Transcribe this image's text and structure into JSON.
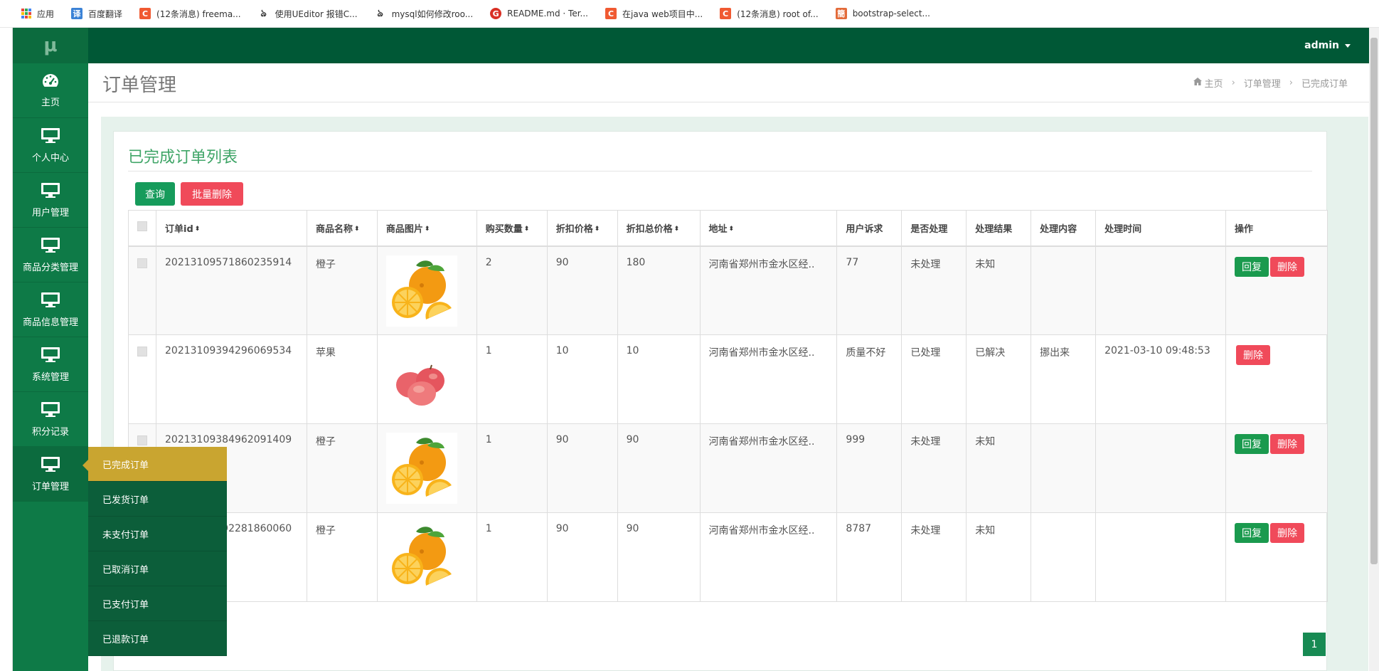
{
  "bookmarks": [
    {
      "icon": "apps-icon",
      "label": "应用"
    },
    {
      "icon": "translate-icon",
      "label": "百度翻译"
    },
    {
      "icon": "csdn-icon",
      "label": "(12条消息) freema..."
    },
    {
      "icon": "yuque-icon",
      "label": "使用UEditor 报错C..."
    },
    {
      "icon": "yuque-icon",
      "label": "mysql如何修改roo..."
    },
    {
      "icon": "gitee-icon",
      "label": "README.md · Ter..."
    },
    {
      "icon": "csdn-icon",
      "label": "在java web项目中..."
    },
    {
      "icon": "csdn-icon",
      "label": "(12条消息) root of..."
    },
    {
      "icon": "jianshu-icon",
      "label": "bootstrap-select..."
    }
  ],
  "logo": "μ",
  "user": {
    "name": "admin"
  },
  "sidebar": {
    "items": [
      {
        "label": "主页",
        "icon": "dashboard-icon"
      },
      {
        "label": "个人中心",
        "icon": "monitor-icon"
      },
      {
        "label": "用户管理",
        "icon": "monitor-icon"
      },
      {
        "label": "商品分类管理",
        "icon": "monitor-icon"
      },
      {
        "label": "商品信息管理",
        "icon": "monitor-icon"
      },
      {
        "label": "系统管理",
        "icon": "monitor-icon"
      },
      {
        "label": "积分记录",
        "icon": "monitor-icon"
      },
      {
        "label": "订单管理",
        "icon": "monitor-icon"
      }
    ]
  },
  "submenu": {
    "items": [
      "已完成订单",
      "已发货订单",
      "未支付订单",
      "已取消订单",
      "已支付订单",
      "已退款订单"
    ]
  },
  "page": {
    "title": "订单管理",
    "breadcrumb": [
      "主页",
      "订单管理",
      "已完成订单"
    ]
  },
  "panel": {
    "title": "已完成订单列表",
    "query_label": "查询",
    "batch_delete_label": "批量删除"
  },
  "table": {
    "headers": [
      "订单id",
      "商品名称",
      "商品图片",
      "购买数量",
      "折扣价格",
      "折扣总价格",
      "地址",
      "用户诉求",
      "是否处理",
      "处理结果",
      "处理内容",
      "处理时间",
      "操作"
    ],
    "reply_label": "回复",
    "delete_label": "删除",
    "rows": [
      {
        "id": "20213109571860235914",
        "name": "橙子",
        "image": "orange",
        "qty": "2",
        "price": "90",
        "total": "180",
        "address": "河南省郑州市金水区经..",
        "request": "77",
        "handled": "未处理",
        "result": "未知",
        "content": "",
        "time": "",
        "can_reply": true
      },
      {
        "id": "20213109394296069534",
        "name": "苹果",
        "image": "apple",
        "qty": "1",
        "price": "10",
        "total": "10",
        "address": "河南省郑州市金水区经..",
        "request": "质量不好",
        "handled": "已处理",
        "result": "已解决",
        "content": "挪出来",
        "time": "2021-03-10 09:48:53",
        "can_reply": false
      },
      {
        "id": "20213109384962091409",
        "name": "橙子",
        "image": "orange",
        "qty": "1",
        "price": "90",
        "total": "90",
        "address": "河南省郑州市金水区经..",
        "request": "999",
        "handled": "未处理",
        "result": "未知",
        "content": "",
        "time": "",
        "can_reply": true
      },
      {
        "id": "20213109292281860060",
        "name": "橙子",
        "image": "orange",
        "qty": "1",
        "price": "90",
        "total": "90",
        "address": "河南省郑州市金水区经..",
        "request": "8787",
        "handled": "未处理",
        "result": "未知",
        "content": "",
        "time": "",
        "can_reply": true
      }
    ]
  },
  "pagination": {
    "current": "1"
  }
}
